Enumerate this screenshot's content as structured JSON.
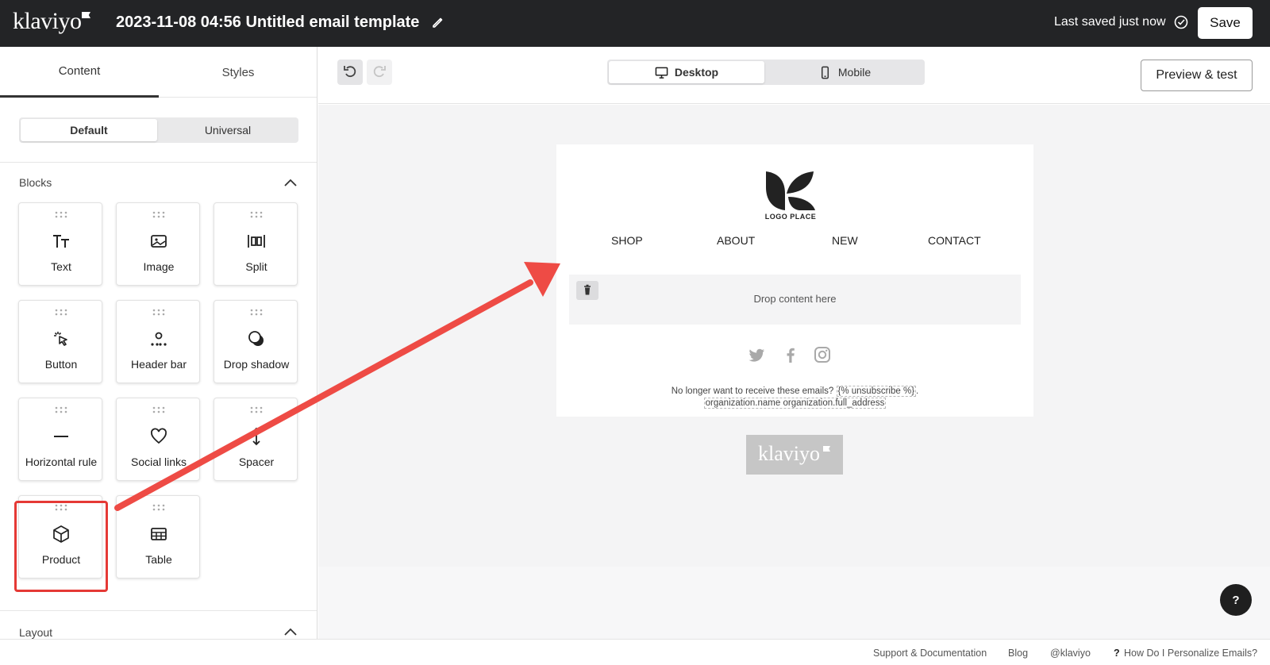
{
  "topbar": {
    "brand": "klaviyo",
    "title": "2023-11-08 04:56 Untitled email template",
    "saved_status": "Last saved just now",
    "save_label": "Save"
  },
  "left_panel": {
    "tabs": [
      "Content",
      "Styles"
    ],
    "segment": [
      "Default",
      "Universal"
    ],
    "blocks_title": "Blocks",
    "blocks": [
      {
        "label": "Text",
        "icon": "text-icon"
      },
      {
        "label": "Image",
        "icon": "image-icon"
      },
      {
        "label": "Split",
        "icon": "split-icon"
      },
      {
        "label": "Button",
        "icon": "cursor-click-icon"
      },
      {
        "label": "Header bar",
        "icon": "header-bar-icon"
      },
      {
        "label": "Drop shadow",
        "icon": "drop-shadow-icon"
      },
      {
        "label": "Horizontal rule",
        "icon": "horizontal-rule-icon"
      },
      {
        "label": "Social links",
        "icon": "heart-icon"
      },
      {
        "label": "Spacer",
        "icon": "spacer-arrows-icon"
      },
      {
        "label": "Product",
        "icon": "cube-icon"
      },
      {
        "label": "Table",
        "icon": "table-icon"
      }
    ],
    "layout_title": "Layout"
  },
  "toolbar": {
    "desktop_label": "Desktop",
    "mobile_label": "Mobile",
    "preview_label": "Preview & test"
  },
  "email": {
    "logo_text": "LOGO PLACE",
    "nav": [
      "SHOP",
      "ABOUT",
      "NEW",
      "CONTACT"
    ],
    "drop_text": "Drop content here",
    "footer_prefix": "No longer want to receive these emails?",
    "unsubscribe_tag": "{% unsubscribe %}",
    "footer_suffix": ".",
    "org_tag": "organization.name organization.full_address",
    "badge_brand": "klaviyo"
  },
  "help_label": "?",
  "statusbar": {
    "links": [
      "Support & Documentation",
      "Blog",
      "@klaviyo",
      "How Do I Personalize Emails?"
    ]
  },
  "colors": {
    "topbar_bg": "#232426",
    "highlight_red": "#e53935",
    "canvas_bg": "#f4f4f5"
  }
}
